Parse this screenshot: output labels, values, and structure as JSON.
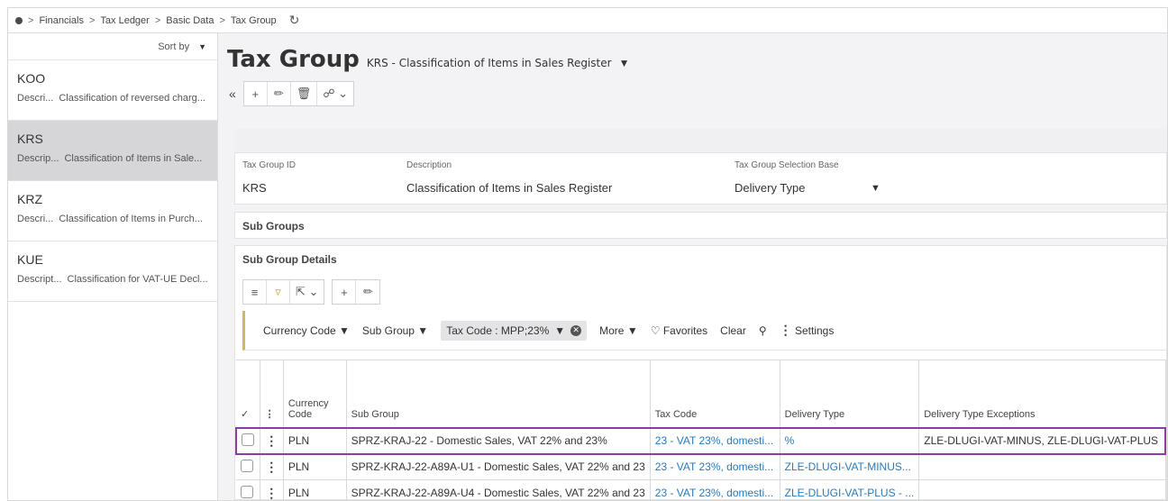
{
  "breadcrumb": {
    "items": [
      "Financials",
      "Tax Ledger",
      "Basic Data",
      "Tax Group"
    ]
  },
  "sidebar": {
    "sort_label": "Sort by",
    "items": [
      {
        "code": "KOO",
        "desc_label": "Descri...",
        "desc": "Classification of reversed charg..."
      },
      {
        "code": "KRS",
        "desc_label": "Descrip...",
        "desc": "Classification of Items in Sale...",
        "selected": true
      },
      {
        "code": "KRZ",
        "desc_label": "Descri...",
        "desc": "Classification of Items in Purch..."
      },
      {
        "code": "KUE",
        "desc_label": "Descript...",
        "desc": "Classification for VAT-UE Decl..."
      }
    ]
  },
  "header": {
    "title": "Tax Group",
    "subtitle": "KRS - Classification of Items in Sales Register"
  },
  "fields": {
    "tax_group_id_label": "Tax Group ID",
    "tax_group_id": "KRS",
    "description_label": "Description",
    "description": "Classification of Items in Sales Register",
    "selection_base_label": "Tax Group Selection Base",
    "selection_base": "Delivery Type"
  },
  "sections": {
    "sub_groups": "Sub Groups",
    "sub_group_details": "Sub Group Details"
  },
  "filters": {
    "currency_code": "Currency Code",
    "sub_group": "Sub Group",
    "tax_code_chip": "Tax Code : MPP;23%",
    "more": "More",
    "favorites": "Favorites",
    "clear": "Clear",
    "settings": "Settings"
  },
  "table": {
    "columns": [
      "Currency Code",
      "Sub Group",
      "Tax Code",
      "Delivery Type",
      "Delivery Type Exceptions"
    ],
    "rows": [
      {
        "currency": "PLN",
        "sub_group": "SPRZ-KRAJ-22 - Domestic Sales, VAT 22% and 23%",
        "tax_code": "23 - VAT 23%, domesti...",
        "delivery_type": "%",
        "exceptions": "ZLE-DLUGI-VAT-MINUS, ZLE-DLUGI-VAT-PLUS"
      },
      {
        "currency": "PLN",
        "sub_group": "SPRZ-KRAJ-22-A89A-U1 - Domestic Sales, VAT 22% and 23",
        "tax_code": "23 - VAT 23%, domesti...",
        "delivery_type": "ZLE-DLUGI-VAT-MINUS...",
        "exceptions": ""
      },
      {
        "currency": "PLN",
        "sub_group": "SPRZ-KRAJ-22-A89A-U4 - Domestic Sales, VAT 22% and 23",
        "tax_code": "23 - VAT 23%, domesti...",
        "delivery_type": "ZLE-DLUGI-VAT-PLUS - ...",
        "exceptions": ""
      }
    ]
  }
}
